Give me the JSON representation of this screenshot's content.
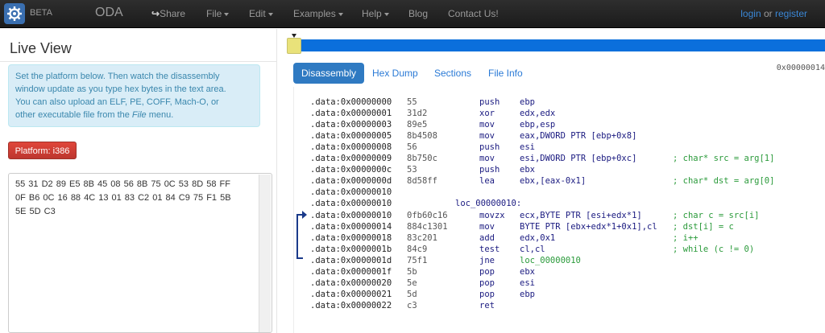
{
  "navbar": {
    "beta": "BETA",
    "brand": "ODA",
    "share": "Share",
    "menus": [
      "File",
      "Edit",
      "Examples",
      "Help"
    ],
    "links": [
      "Blog",
      "Contact Us!"
    ],
    "login": "login",
    "or": "or",
    "register": "register"
  },
  "left": {
    "title": "Live View",
    "info_line1": "Set the platform below. Then watch the disassembly",
    "info_line2": "window update as you type hex bytes in the text area.",
    "info_line3": "You can also upload an ELF, PE, COFF, Mach-O, or",
    "info_line4_a": "other executable file from the ",
    "info_line4_b": "File",
    "info_line4_c": " menu.",
    "platform_button": "Platform: i386",
    "hex_text": "55 31 D2 89 E5 8B 45 08 56 8B 75 0C 53 8D 58 FF\n0F B6 0C 16 88 4C 13 01 83 C2 01 84 C9 75 F1 5B\n5E 5D C3"
  },
  "tabs": [
    "Disassembly",
    "Hex Dump",
    "Sections",
    "File Info"
  ],
  "offset": "0x00000014",
  "disassembly": [
    {
      "addr": ".data:0x00000000",
      "bytes": "55",
      "mnem": "push",
      "ops": "ebp",
      "cmt": ""
    },
    {
      "addr": ".data:0x00000001",
      "bytes": "31d2",
      "mnem": "xor",
      "ops": "edx,edx",
      "cmt": ""
    },
    {
      "addr": ".data:0x00000003",
      "bytes": "89e5",
      "mnem": "mov",
      "ops": "ebp,esp",
      "cmt": ""
    },
    {
      "addr": ".data:0x00000005",
      "bytes": "8b4508",
      "mnem": "mov",
      "ops": "eax,DWORD PTR [ebp+0x8]",
      "cmt": ""
    },
    {
      "addr": ".data:0x00000008",
      "bytes": "56",
      "mnem": "push",
      "ops": "esi",
      "cmt": ""
    },
    {
      "addr": ".data:0x00000009",
      "bytes": "8b750c",
      "mnem": "mov",
      "ops": "esi,DWORD PTR [ebp+0xc]",
      "cmt": "; char* src = arg[1]"
    },
    {
      "addr": ".data:0x0000000c",
      "bytes": "53",
      "mnem": "push",
      "ops": "ebx",
      "cmt": ""
    },
    {
      "addr": ".data:0x0000000d",
      "bytes": "8d58ff",
      "mnem": "lea",
      "ops": "ebx,[eax-0x1]",
      "cmt": "; char* dst = arg[0]"
    },
    {
      "addr": ".data:0x00000010",
      "bytes": "",
      "mnem": "",
      "ops": "",
      "cmt": ""
    },
    {
      "addr": ".data:0x00000010",
      "label": "loc_00000010:"
    },
    {
      "addr": ".data:0x00000010",
      "bytes": "0fb60c16",
      "mnem": "movzx",
      "ops": "ecx,BYTE PTR [esi+edx*1]",
      "cmt": "; char c = src[i]"
    },
    {
      "addr": ".data:0x00000014",
      "bytes": "884c1301",
      "mnem": "mov",
      "ops": "BYTE PTR [ebx+edx*1+0x1],cl",
      "cmt": "; dst[i] = c"
    },
    {
      "addr": ".data:0x00000018",
      "bytes": "83c201",
      "mnem": "add",
      "ops": "edx,0x1",
      "cmt": "; i++"
    },
    {
      "addr": ".data:0x0000001b",
      "bytes": "84c9",
      "mnem": "test",
      "ops": "cl,cl",
      "cmt": "; while (c != 0)"
    },
    {
      "addr": ".data:0x0000001d",
      "bytes": "75f1",
      "mnem": "jne",
      "ops": "loc_00000010",
      "cmt": "",
      "ops_is_label": true
    },
    {
      "addr": ".data:0x0000001f",
      "bytes": "5b",
      "mnem": "pop",
      "ops": "ebx",
      "cmt": ""
    },
    {
      "addr": ".data:0x00000020",
      "bytes": "5e",
      "mnem": "pop",
      "ops": "esi",
      "cmt": ""
    },
    {
      "addr": ".data:0x00000021",
      "bytes": "5d",
      "mnem": "pop",
      "ops": "ebp",
      "cmt": ""
    },
    {
      "addr": ".data:0x00000022",
      "bytes": "c3",
      "mnem": "ret",
      "ops": "",
      "cmt": ""
    }
  ],
  "colors": {
    "navbar": "#1b1b1b",
    "timeline": "#0b6fdc",
    "active_tab": "#2f7ac2",
    "platform_button": "#bd362f",
    "comment": "#2a9a3a"
  },
  "icons": [
    "gear-logo-icon",
    "share-icon",
    "caret-down-icon",
    "loop-arrow-icon"
  ]
}
